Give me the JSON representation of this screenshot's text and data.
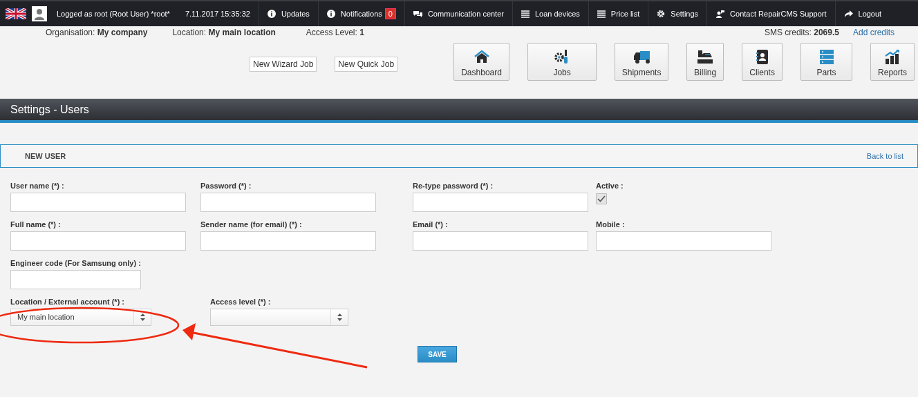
{
  "top_bar": {
    "user_text": "Logged as root (Root User) *root*",
    "datetime": "7.11.2017 15:35:32",
    "items": [
      {
        "label": "Updates"
      },
      {
        "label": "Notifications",
        "badge": "0"
      },
      {
        "label": "Communication center"
      },
      {
        "label": "Loan devices"
      },
      {
        "label": "Price list"
      },
      {
        "label": "Settings"
      },
      {
        "label": "Contact RepairCMS Support"
      },
      {
        "label": "Logout"
      }
    ]
  },
  "info_bar": {
    "fields": [
      {
        "label": "Organisation:",
        "value": "My company"
      },
      {
        "label": "Location:",
        "value": "My main location"
      },
      {
        "label": "Access Level:",
        "value": "1"
      }
    ],
    "sms_label": "SMS credits:",
    "sms_value": "2069.5",
    "add_credits": "Add credits"
  },
  "quick_buttons": [
    "New Wizard Job",
    "New Quick Job"
  ],
  "nav_buttons": [
    {
      "label": "Dashboard"
    },
    {
      "label": "Jobs"
    },
    {
      "label": "Shipments"
    },
    {
      "label": "Billing"
    },
    {
      "label": "Clients"
    },
    {
      "label": "Parts"
    },
    {
      "label": "Reports"
    }
  ],
  "page_title": "Settings - Users",
  "panel": {
    "title": "NEW USER",
    "back_link": "Back to list"
  },
  "form_rows": [
    [
      {
        "kind": "text",
        "label": "User name (*) :"
      },
      {
        "kind": "text",
        "label": "Password (*) :"
      },
      {
        "kind": "text",
        "label": "Re-type password (*) :"
      },
      {
        "kind": "checkbox",
        "label": "Active :",
        "checked": true
      }
    ],
    [
      {
        "kind": "text",
        "label": "Full name (*) :"
      },
      {
        "kind": "text",
        "label": "Sender name (for email) (*) :"
      },
      {
        "kind": "text",
        "label": "Email (*) :"
      },
      {
        "kind": "text",
        "label": "Mobile :"
      }
    ],
    [
      {
        "kind": "text",
        "label": "Engineer code (For Samsung only) :"
      }
    ],
    [
      {
        "kind": "select",
        "label": "Location / External account (*) :",
        "value": "My main location"
      },
      {
        "kind": "select",
        "label": "Access level (*) :"
      }
    ]
  ],
  "save_button": "SAVE"
}
